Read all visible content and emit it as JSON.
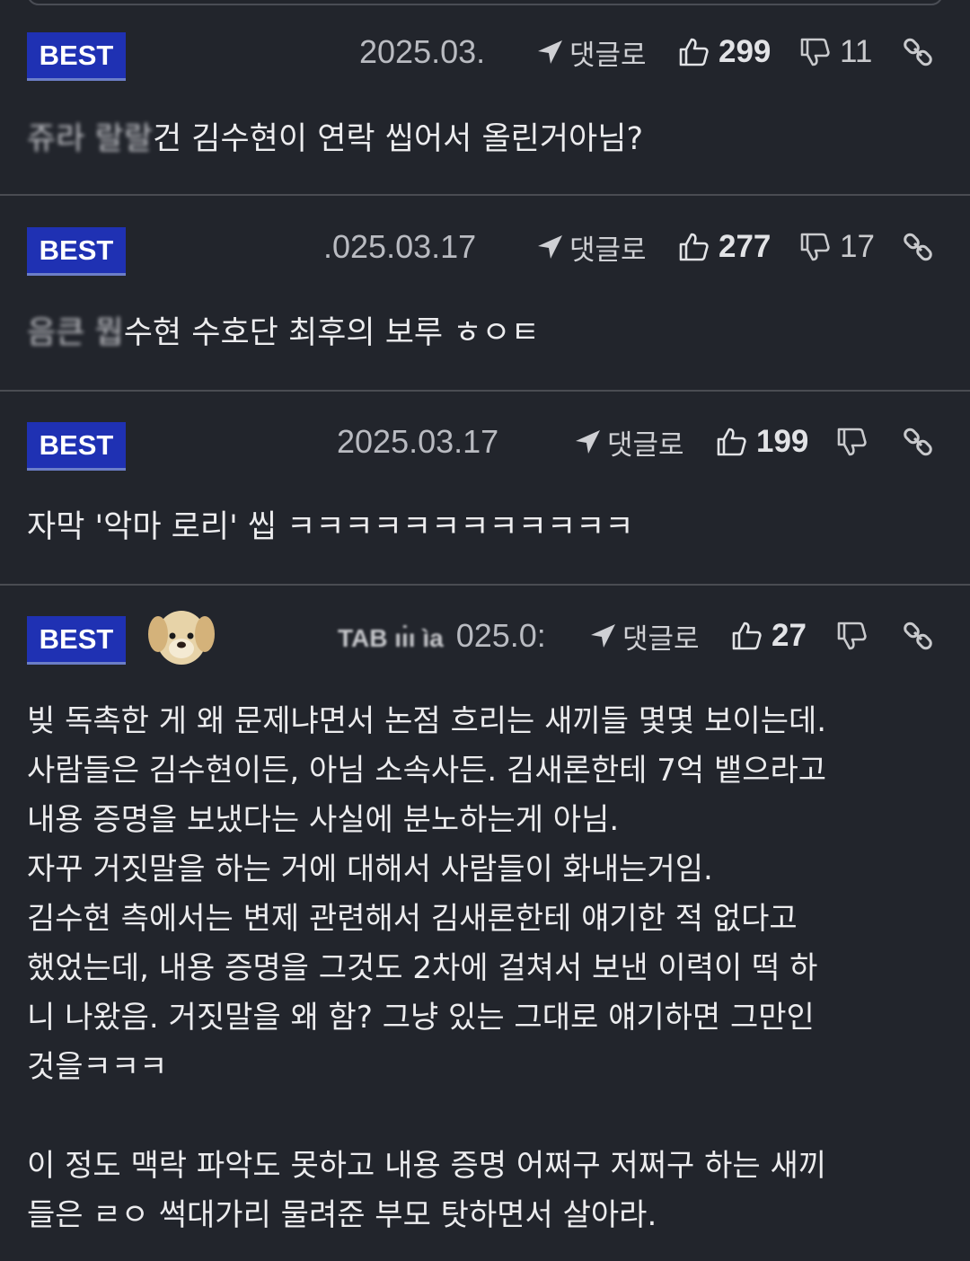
{
  "comments": [
    {
      "badge": "BEST",
      "user": "",
      "date": "2025.03.",
      "reply_label": "댓글로",
      "likes": "299",
      "dislikes": "11",
      "text_hidden": "쥬라 랄랄",
      "text": "건 김수현이 연락 씹어서 올린거아님?"
    },
    {
      "badge": "BEST",
      "user": "",
      "date": ".025.03.17",
      "reply_label": "댓글로",
      "likes": "277",
      "dislikes": "17",
      "text_hidden": "음큰 뭡",
      "text": "수현 수호단 최후의 보루 ㅎㅇㅌ"
    },
    {
      "badge": "BEST",
      "user": "",
      "date": "2025.03.17",
      "reply_label": "댓글로",
      "likes": "199",
      "dislikes": "",
      "text": "자막 '악마 로리' 씹 ㅋㅋㅋㅋㅋㅋㅋㅋㅋㅋㅋㅋ"
    },
    {
      "badge": "BEST",
      "user": "TAB ıı̇ı ìa",
      "date": "025.0:",
      "reply_label": "댓글로",
      "likes": "27",
      "dislikes": "",
      "text": "빚 독촉한 게 왜 문제냐면서 논점 흐리는 새끼들 몇몇 보이는데.\n사람들은 김수현이든, 아님 소속사든. 김새론한테 7억 뱉으라고\n내용 증명을 보냈다는 사실에 분노하는게 아님.\n자꾸 거짓말을 하는 거에 대해서 사람들이 화내는거임.\n김수현 측에서는 변제 관련해서 김새론한테 얘기한 적 없다고\n했었는데, 내용 증명을 그것도 2차에 걸쳐서 보낸 이력이 떡 하\n니 나왔음. 거짓말을 왜 함? 그냥 있는 그대로 얘기하면 그만인\n것을ㅋㅋㅋ\n\n이 정도 맥락 파악도 못하고 내용 증명 어쩌구 저쩌구 하는 새끼\n들은 ㄹㅇ 썩대가리 물려준 부모 탓하면서 살아라."
    }
  ],
  "colors": {
    "background": "#22252c",
    "badge": "#1f31b3",
    "divider": "#4a4c52"
  },
  "icons": [
    "reply-arrow-icon",
    "thumbs-up-icon",
    "thumbs-down-icon",
    "link-icon",
    "avatar-puppy"
  ]
}
